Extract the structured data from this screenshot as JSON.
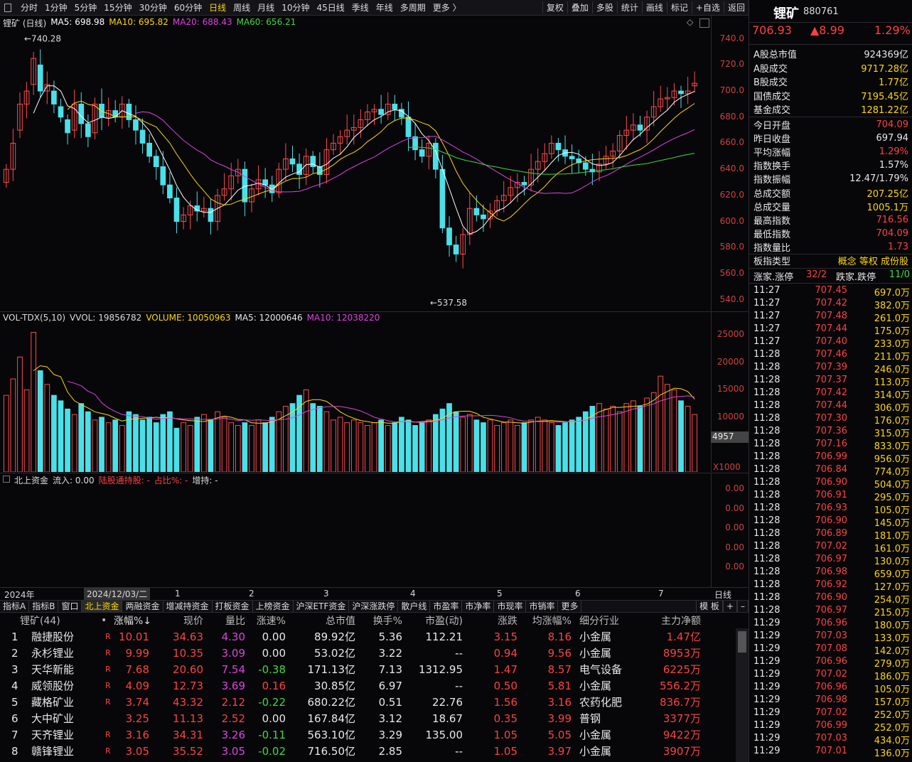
{
  "toolbar": {
    "periods": [
      "分时",
      "1分钟",
      "5分钟",
      "15分钟",
      "30分钟",
      "60分钟",
      "日线",
      "周线",
      "月线",
      "10分钟",
      "45日线",
      "季线",
      "年线",
      "多周期",
      "更多 〉"
    ],
    "active_period": "日线",
    "right": [
      "复权",
      "叠加",
      "多股",
      "统计",
      "画线",
      "标记",
      "+自选",
      "返回"
    ]
  },
  "kline": {
    "title": "锂矿 (日线)",
    "ma": [
      {
        "label": "MA5: 698.98",
        "color": "#ffffff"
      },
      {
        "label": "MA10: 695.82",
        "color": "#ffd700"
      },
      {
        "label": "MA20: 688.43",
        "color": "#e040e0"
      },
      {
        "label": "MA60: 656.21",
        "color": "#3cdc3c"
      }
    ],
    "high_label": "740.28",
    "low_label": "537.58",
    "y_ticks": [
      "740.0",
      "720.0",
      "700.0",
      "680.0",
      "660.0",
      "640.0",
      "620.0",
      "600.0",
      "580.0",
      "560.0",
      "540.0"
    ]
  },
  "volume": {
    "title": "VOL-TDX(5,10)",
    "vvol": "VVOL: 19856782",
    "volume": "VOLUME: 10050963",
    "ma5": "MA5: 12000646",
    "ma10": "MA10: 12038220",
    "y_ticks": [
      "25000",
      "20000",
      "15000",
      "10000"
    ],
    "cursor_value": "4957",
    "unit": "X1000"
  },
  "north": {
    "title": "北上资金",
    "inflow": "流入: 0.00",
    "holding": "陆股通持股: -",
    "ratio": "占比%: -",
    "change": "增持: -",
    "y_ticks": [
      "0.00",
      "0.00",
      "0.00",
      "0.00",
      "0.00"
    ]
  },
  "xaxis": {
    "year": "2024年",
    "cursor_date": "2024/12/03/二",
    "months": [
      "1",
      "2",
      "3",
      "4",
      "5",
      "6",
      "7"
    ],
    "period_button": "日线"
  },
  "tabs": [
    "指标A",
    "指标B",
    "窗口",
    "北上资金",
    "两融资金",
    "增减持资金",
    "打板资金",
    "上榜资金",
    "沪深ETF资金",
    "沪深涨跌停",
    "散户线",
    "市盈率",
    "市净率",
    "市现率",
    "市销率",
    "更多"
  ],
  "active_tab": "北上资金",
  "tabs_right": [
    "模 板",
    "+",
    "–"
  ],
  "table": {
    "headers": [
      "锂矿(44)",
      "•",
      "涨幅%↓",
      "现价",
      "量比",
      "涨速%",
      "总市值",
      "换手%",
      "市盈(动)",
      "涨跌",
      "均涨幅%",
      "细分行业",
      "主力净额"
    ],
    "rows": [
      {
        "no": "1",
        "name": "融捷股份",
        "r": "R",
        "chg": "10.01",
        "price": "34.63",
        "vr": "4.30",
        "speed": "0.00",
        "cap": "89.92亿",
        "turn": "5.36",
        "pe": "112.21",
        "diff": "3.15",
        "avg": "8.16",
        "ind": "小金属",
        "net": "1.47亿",
        "vr_c": "mag",
        "speed_c": "white"
      },
      {
        "no": "2",
        "name": "永杉锂业",
        "r": "R",
        "chg": "9.99",
        "price": "10.35",
        "vr": "3.09",
        "speed": "0.00",
        "cap": "53.02亿",
        "turn": "3.22",
        "pe": "--",
        "diff": "0.94",
        "avg": "9.56",
        "ind": "小金属",
        "net": "8953万",
        "vr_c": "mag",
        "speed_c": "white"
      },
      {
        "no": "3",
        "name": "天华新能",
        "r": "R",
        "chg": "7.68",
        "price": "20.60",
        "vr": "7.54",
        "speed": "-0.38",
        "cap": "171.13亿",
        "turn": "7.13",
        "pe": "1312.95",
        "diff": "1.47",
        "avg": "8.57",
        "ind": "电气设备",
        "net": "6225万",
        "vr_c": "mag",
        "speed_c": "green"
      },
      {
        "no": "4",
        "name": "威领股份",
        "r": "R",
        "chg": "4.09",
        "price": "12.73",
        "vr": "3.69",
        "speed": "0.16",
        "cap": "30.85亿",
        "turn": "6.97",
        "pe": "--",
        "diff": "0.50",
        "avg": "5.81",
        "ind": "小金属",
        "net": "556.2万",
        "vr_c": "mag",
        "speed_c": "red"
      },
      {
        "no": "5",
        "name": "藏格矿业",
        "r": "R",
        "chg": "3.74",
        "price": "43.32",
        "vr": "2.12",
        "speed": "-0.22",
        "cap": "680.22亿",
        "turn": "0.51",
        "pe": "22.76",
        "diff": "1.56",
        "avg": "3.16",
        "ind": "农药化肥",
        "net": "836.7万",
        "vr_c": "red",
        "speed_c": "green"
      },
      {
        "no": "6",
        "name": "大中矿业",
        "r": "",
        "chg": "3.25",
        "price": "11.13",
        "vr": "2.52",
        "speed": "0.00",
        "cap": "167.84亿",
        "turn": "3.12",
        "pe": "18.67",
        "diff": "0.35",
        "avg": "3.99",
        "ind": "普钢",
        "net": "3377万",
        "vr_c": "red",
        "speed_c": "white"
      },
      {
        "no": "7",
        "name": "天齐锂业",
        "r": "R",
        "chg": "3.16",
        "price": "34.31",
        "vr": "3.26",
        "speed": "-0.11",
        "cap": "563.10亿",
        "turn": "3.29",
        "pe": "135.00",
        "diff": "1.05",
        "avg": "5.05",
        "ind": "小金属",
        "net": "9422万",
        "vr_c": "mag",
        "speed_c": "green"
      },
      {
        "no": "8",
        "name": "赣锋锂业",
        "r": "R",
        "chg": "3.05",
        "price": "35.52",
        "vr": "3.05",
        "speed": "-0.02",
        "cap": "716.50亿",
        "turn": "2.85",
        "pe": "--",
        "diff": "1.05",
        "avg": "3.97",
        "ind": "小金属",
        "net": "3907万",
        "vr_c": "mag",
        "speed_c": "green"
      }
    ]
  },
  "side": {
    "name": "锂矿",
    "code": "880761",
    "price": "706.93",
    "change": "▲8.99",
    "pct": "1.29%",
    "stats": [
      {
        "k": "A股总市值",
        "v": "924369亿",
        "c": "white"
      },
      {
        "k": "A股成交",
        "v": "9717.28亿",
        "c": "yellow"
      },
      {
        "k": "B股成交",
        "v": "1.77亿",
        "c": "yellow"
      },
      {
        "k": "国债成交",
        "v": "7195.45亿",
        "c": "yellow"
      },
      {
        "k": "基金成交",
        "v": "1281.22亿",
        "c": "yellow"
      }
    ],
    "quote": [
      {
        "k": "今日开盘",
        "v": "704.09",
        "c": "red"
      },
      {
        "k": "昨日收盘",
        "v": "697.94",
        "c": "white"
      },
      {
        "k": "平均涨幅",
        "v": "1.29%",
        "c": "red"
      },
      {
        "k": "指数换手",
        "v": "1.57%",
        "c": "white"
      },
      {
        "k": "指数振幅",
        "v": "12.47/1.79%",
        "c": "white"
      },
      {
        "k": "总成交额",
        "v": "207.25亿",
        "c": "yellow"
      },
      {
        "k": "总成交量",
        "v": "1005.1万",
        "c": "yellow"
      },
      {
        "k": "最高指数",
        "v": "716.56",
        "c": "red"
      },
      {
        "k": "最低指数",
        "v": "704.09",
        "c": "red"
      },
      {
        "k": "指数量比",
        "v": "1.73",
        "c": "red"
      }
    ],
    "board_type": {
      "k": "板指类型",
      "v": "概念 等权 成份股"
    },
    "updown": {
      "k1": "涨家.涨停",
      "v1": "32/2",
      "k2": "跌家.跌停",
      "v2": "11/0"
    },
    "ticks": [
      [
        "11:27",
        "707.45",
        "697.0万"
      ],
      [
        "11:27",
        "707.42",
        "382.0万"
      ],
      [
        "11:27",
        "707.48",
        "261.0万"
      ],
      [
        "11:27",
        "707.44",
        "175.0万"
      ],
      [
        "11:27",
        "707.40",
        "233.0万"
      ],
      [
        "11:28",
        "707.46",
        "211.0万"
      ],
      [
        "11:28",
        "707.39",
        "246.0万"
      ],
      [
        "11:28",
        "707.37",
        "113.0万"
      ],
      [
        "11:28",
        "707.42",
        "314.0万"
      ],
      [
        "11:28",
        "707.44",
        "306.0万"
      ],
      [
        "11:28",
        "707.30",
        "176.0万"
      ],
      [
        "11:28",
        "707.36",
        "315.0万"
      ],
      [
        "11:28",
        "707.16",
        "833.0万"
      ],
      [
        "11:28",
        "706.99",
        "956.0万"
      ],
      [
        "11:28",
        "706.84",
        "774.0万"
      ],
      [
        "11:28",
        "706.90",
        "504.0万"
      ],
      [
        "11:28",
        "706.91",
        "295.0万"
      ],
      [
        "11:28",
        "706.93",
        "105.0万"
      ],
      [
        "11:28",
        "706.90",
        "145.0万"
      ],
      [
        "11:28",
        "706.89",
        "181.0万"
      ],
      [
        "11:28",
        "707.02",
        "161.0万"
      ],
      [
        "11:28",
        "706.97",
        "130.0万"
      ],
      [
        "11:28",
        "706.98",
        "659.0万"
      ],
      [
        "11:28",
        "706.92",
        "127.0万"
      ],
      [
        "11:28",
        "706.90",
        "254.0万"
      ],
      [
        "11:28",
        "706.97",
        "215.0万"
      ],
      [
        "11:29",
        "706.96",
        "180.0万"
      ],
      [
        "11:29",
        "707.03",
        "133.0万"
      ],
      [
        "11:29",
        "707.08",
        "142.0万"
      ],
      [
        "11:29",
        "706.96",
        "279.0万"
      ],
      [
        "11:29",
        "707.02",
        "186.0万"
      ],
      [
        "11:29",
        "706.96",
        "105.0万"
      ],
      [
        "11:29",
        "706.98",
        "157.0万"
      ],
      [
        "11:29",
        "707.02",
        "252.0万"
      ],
      [
        "11:29",
        "706.99",
        "252.0万"
      ],
      [
        "11:29",
        "707.03",
        "434.0万"
      ],
      [
        "11:29",
        "707.01",
        "136.0万"
      ]
    ]
  },
  "chart_data": {
    "type": "candlestick",
    "ylim": [
      530,
      748
    ],
    "closes": [
      640,
      660,
      690,
      700,
      725,
      700,
      705,
      690,
      680,
      668,
      690,
      675,
      665,
      690,
      680,
      685,
      680,
      690,
      678,
      670,
      660,
      650,
      642,
      628,
      618,
      600,
      605,
      612,
      608,
      610,
      600,
      620,
      625,
      635,
      640,
      615,
      625,
      632,
      628,
      622,
      640,
      648,
      644,
      636,
      650,
      642,
      636,
      655,
      660,
      665,
      670,
      672,
      678,
      684,
      686,
      682,
      690,
      686,
      680,
      665,
      655,
      650,
      660,
      640,
      595,
      582,
      575,
      590,
      610,
      605,
      602,
      608,
      616,
      620,
      626,
      630,
      628,
      640,
      646,
      652,
      660,
      655,
      650,
      648,
      645,
      640,
      638,
      644,
      650,
      654,
      666,
      670,
      674,
      670,
      680,
      688,
      694,
      695,
      700,
      698,
      700,
      706
    ],
    "opens": [
      630,
      640,
      670,
      690,
      705,
      720,
      700,
      700,
      688,
      678,
      670,
      690,
      675,
      668,
      690,
      680,
      685,
      680,
      690,
      678,
      670,
      660,
      650,
      642,
      628,
      618,
      600,
      605,
      612,
      608,
      610,
      600,
      620,
      625,
      635,
      640,
      615,
      625,
      632,
      628,
      622,
      640,
      648,
      644,
      636,
      650,
      642,
      636,
      655,
      660,
      665,
      670,
      672,
      678,
      684,
      686,
      682,
      690,
      686,
      680,
      665,
      655,
      650,
      660,
      640,
      595,
      582,
      575,
      590,
      610,
      605,
      602,
      608,
      616,
      620,
      626,
      630,
      628,
      640,
      646,
      652,
      660,
      655,
      650,
      648,
      645,
      640,
      638,
      644,
      650,
      654,
      666,
      670,
      674,
      670,
      680,
      688,
      694,
      695,
      700,
      698,
      704
    ],
    "volumes": [
      14000,
      17000,
      21000,
      15000,
      25500,
      18500,
      16000,
      14000,
      13000,
      11500,
      10500,
      12500,
      11000,
      9500,
      10000,
      9000,
      9500,
      8500,
      11000,
      10500,
      9500,
      10000,
      9000,
      10500,
      11000,
      8000,
      9000,
      8500,
      10000,
      10500,
      9500,
      11000,
      10000,
      9000,
      8500,
      9000,
      8500,
      9500,
      9000,
      10000,
      11000,
      12000,
      12500,
      14000,
      15000,
      12500,
      12000,
      11000,
      9500,
      10000,
      9000,
      9500,
      9000,
      8500,
      9000,
      9500,
      8500,
      9000,
      10000,
      9500,
      8500,
      9000,
      9500,
      10500,
      11500,
      12500,
      11000,
      10000,
      10500,
      9500,
      9000,
      9500,
      8500,
      9000,
      9500,
      8500,
      9000,
      9500,
      10000,
      9500,
      9000,
      8500,
      9000,
      9500,
      10000,
      11000,
      12000,
      12500,
      11500,
      12000,
      11000,
      12500,
      13000,
      12000,
      13500,
      14500,
      17500,
      16000,
      15000,
      13000,
      12000,
      10500
    ],
    "hi": "740.28",
    "lo": "537.58"
  }
}
